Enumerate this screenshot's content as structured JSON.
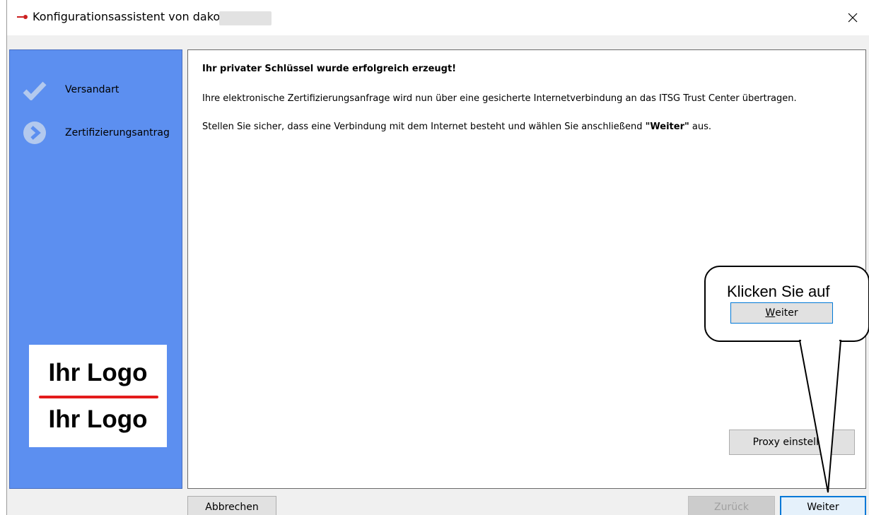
{
  "window": {
    "title": "Konfigurationsassistent von dakota.ag",
    "close_symbol": "×",
    "icon": "app-icon"
  },
  "sidebar": {
    "steps": [
      {
        "label": "Versandart",
        "icon": "check-icon"
      },
      {
        "label": "Zertifizierungsantrag",
        "icon": "arrow-circle-icon"
      }
    ],
    "logo": {
      "top_text": "Ihr Logo",
      "bottom_text": "Ihr Logo",
      "divider_color": "#e31b1b"
    },
    "background_color": "#5c8ff0"
  },
  "content": {
    "heading": "Ihr privater Schlüssel wurde erfolgreich erzeugt!",
    "paragraph1": "Ihre elektronische Zertifizierungsanfrage wird nun über eine gesicherte Internetverbindung an das ITSG Trust Center übertragen.",
    "paragraph2_before": "Stellen Sie sicher, dass eine Verbindung mit dem Internet besteht und wählen Sie anschließend ",
    "paragraph2_bold": "\"Weiter\"",
    "paragraph2_after": " aus.",
    "proxy_button": "Proxy einstellen"
  },
  "footer": {
    "cancel_button": "Abbrechen",
    "back_button": "Zurück",
    "next_button": "Weiter"
  },
  "callout": {
    "text": "Klicken Sie auf",
    "button_underlined": "W",
    "button_rest": "eiter"
  }
}
